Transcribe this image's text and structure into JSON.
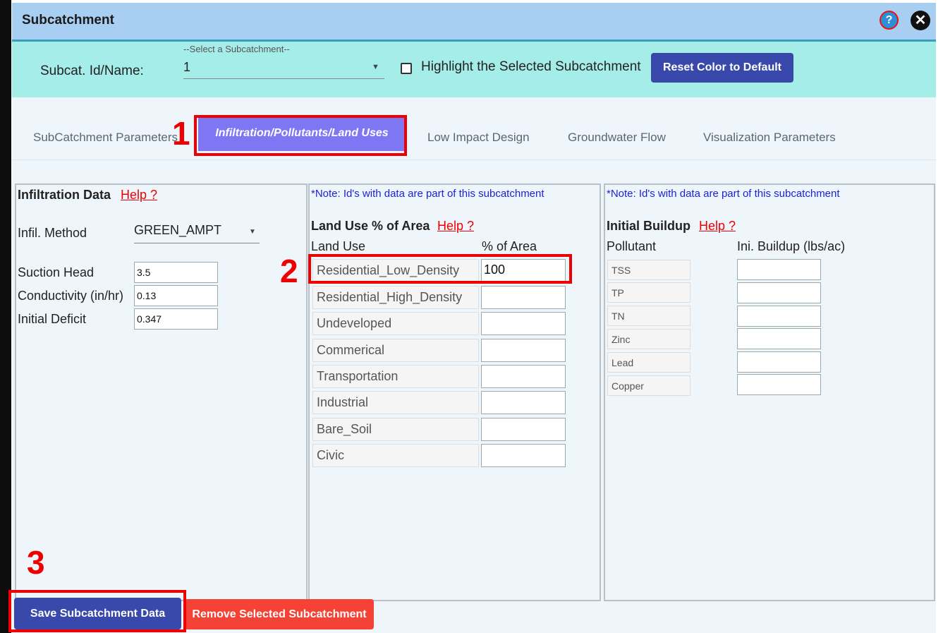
{
  "window": {
    "title": "Subcatchment",
    "help_icon": "?",
    "close_icon": "✕"
  },
  "selector": {
    "label": "Subcat. Id/Name:",
    "hint": "--Select a Subcatchment--",
    "value": "1",
    "highlight_label": "Highlight the Selected Subcatchment",
    "highlight_checked": false,
    "reset_button": "Reset Color to Default"
  },
  "tabs": {
    "subcatchment": "SubCatchment Parameters",
    "infiltration": "Infiltration/Pollutants/Land Uses",
    "lid": "Low Impact Design",
    "groundwater": "Groundwater Flow",
    "visualization": "Visualization Parameters",
    "active": "infiltration"
  },
  "annotations": {
    "one": "1",
    "two": "2",
    "three": "3"
  },
  "infiltration": {
    "title": "Infiltration Data",
    "help": "Help ?",
    "method_label": "Infil. Method",
    "method_value": "GREEN_AMPT",
    "fields": [
      {
        "label": "Suction Head",
        "value": "3.5"
      },
      {
        "label": "Conductivity (in/hr)",
        "value": "0.13"
      },
      {
        "label": "Initial Deficit",
        "value": "0.347"
      }
    ]
  },
  "land_use": {
    "note": "*Note: Id's with data are part of this subcatchment",
    "title": "Land Use % of Area",
    "help": "Help ?",
    "col_landuse": "Land Use",
    "col_area": "% of Area",
    "rows": [
      {
        "name": "Residential_Low_Density",
        "value": "100"
      },
      {
        "name": "Residential_High_Density",
        "value": ""
      },
      {
        "name": "Undeveloped",
        "value": ""
      },
      {
        "name": "Commerical",
        "value": ""
      },
      {
        "name": "Transportation",
        "value": ""
      },
      {
        "name": "Industrial",
        "value": ""
      },
      {
        "name": "Bare_Soil",
        "value": ""
      },
      {
        "name": "Civic",
        "value": ""
      }
    ]
  },
  "buildup": {
    "note": "*Note: Id's with data are part of this subcatchment",
    "title": "Initial Buildup",
    "help": "Help ?",
    "col_pollutant": "Pollutant",
    "col_buildup": "Ini. Buildup (lbs/ac)",
    "rows": [
      {
        "name": "TSS",
        "value": ""
      },
      {
        "name": "TP",
        "value": ""
      },
      {
        "name": "TN",
        "value": ""
      },
      {
        "name": "Zinc",
        "value": ""
      },
      {
        "name": "Lead",
        "value": ""
      },
      {
        "name": "Copper",
        "value": ""
      }
    ]
  },
  "actions": {
    "save": "Save Subcatchment Data",
    "remove": "Remove Selected Subcatchment"
  }
}
